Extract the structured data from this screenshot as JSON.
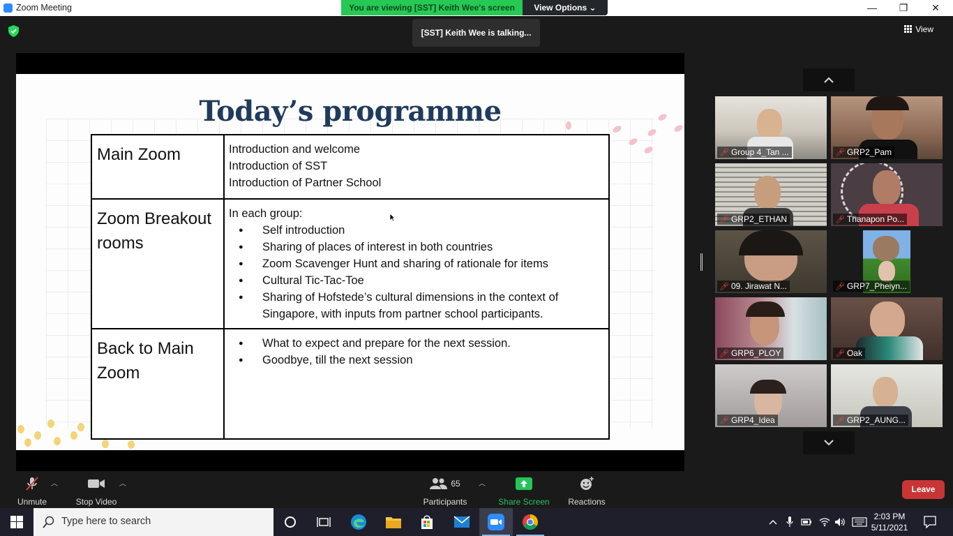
{
  "window": {
    "title": "Zoom Meeting",
    "viewing_banner": "You are viewing [SST] Keith Wee's screen",
    "view_options": "View Options",
    "minimize": "—",
    "restore": "❐",
    "close": "✕"
  },
  "meeting": {
    "talking_tip": "[SST] Keith Wee is talking...",
    "view_label": "View",
    "security_color": "#23d959"
  },
  "slide": {
    "title": "Today’s programme",
    "rows": [
      {
        "label": "Main Zoom",
        "lines": [
          "Introduction and welcome",
          "Introduction of SST",
          "Introduction of Partner School"
        ],
        "bullets": []
      },
      {
        "label": "Zoom Breakout rooms",
        "lines": [
          "In each group:"
        ],
        "bullets": [
          "Self introduction",
          "Sharing of places of interest in both countries",
          "Zoom Scavenger Hunt and sharing of rationale for items",
          "Cultural Tic-Tac-Toe",
          "Sharing of Hofstede’s cultural dimensions in the context of Singapore, with inputs from partner school participants."
        ]
      },
      {
        "label": "Back to Main Zoom",
        "lines": [],
        "bullets": [
          "What to expect and prepare for the next session.",
          "Goodbye, till the next session"
        ]
      }
    ]
  },
  "gallery": {
    "participants": [
      {
        "name": "Group 4_Tan ...",
        "bg": "#cfcac1"
      },
      {
        "name": "GRP2_Pam",
        "bg": "#9c7b66"
      },
      {
        "name": "GRP2_ETHAN",
        "bg": "#b8b3a8"
      },
      {
        "name": "Thanapon Po...",
        "bg": "#5a4d52"
      },
      {
        "name": "09. Jirawat N...",
        "bg": "#4a4338"
      },
      {
        "name": "GRP7_Pheiyn...",
        "bg": "#2e3a2a"
      },
      {
        "name": "GRP6_PLOY",
        "bg": "#8b5f6b"
      },
      {
        "name": "Oak",
        "bg": "#5d4a44"
      },
      {
        "name": "GRP4_Idea",
        "bg": "#a9a3a4"
      },
      {
        "name": "GRP2_AUNG...",
        "bg": "#d6d6cf"
      }
    ]
  },
  "controls": {
    "unmute": "Unmute",
    "stop_video": "Stop Video",
    "participants": "Participants",
    "participants_count": "65",
    "share_screen": "Share Screen",
    "reactions": "Reactions",
    "leave": "Leave"
  },
  "taskbar": {
    "search_placeholder": "Type here to search",
    "time": "2:03 PM",
    "date": "5/11/2021"
  }
}
